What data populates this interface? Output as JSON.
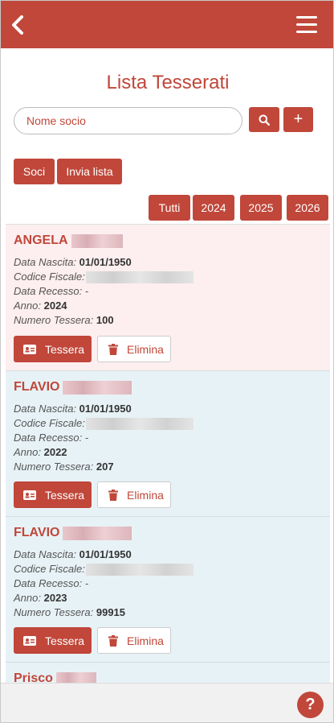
{
  "header": {
    "back_icon": "chevron-left-icon",
    "menu_icon": "hamburger-icon",
    "bar_color": "#c0473a"
  },
  "title": "Lista Tesserati",
  "search": {
    "placeholder": "Nome socio",
    "value": ""
  },
  "buttons": {
    "search_icon": "search-icon",
    "add_label": "+",
    "soci": "Soci",
    "invia": "Invia lista"
  },
  "year_filters": [
    "Tutti",
    "2024",
    "2025",
    "2026"
  ],
  "labels": {
    "nascita": "Data Nascita:",
    "codice": "Codice Fiscale:",
    "recesso": "Data Recesso:",
    "anno": "Anno:",
    "numero": "Numero Tessera:",
    "tessera_btn": "Tessera",
    "elimina_btn": "Elimina"
  },
  "members": [
    {
      "first_name": "ANGELA",
      "nascita": "01/01/1950",
      "recesso": "-",
      "anno": "2024",
      "numero": "100",
      "highlight": "pink"
    },
    {
      "first_name": "FLAVIO",
      "nascita": "01/01/1950",
      "recesso": "-",
      "anno": "2022",
      "numero": "207",
      "highlight": "blue"
    },
    {
      "first_name": "FLAVIO",
      "nascita": "01/01/1950",
      "recesso": "-",
      "anno": "2023",
      "numero": "99915",
      "highlight": "blue"
    },
    {
      "first_name": "Prisco",
      "highlight": "blue"
    }
  ],
  "help": {
    "label": "?"
  }
}
